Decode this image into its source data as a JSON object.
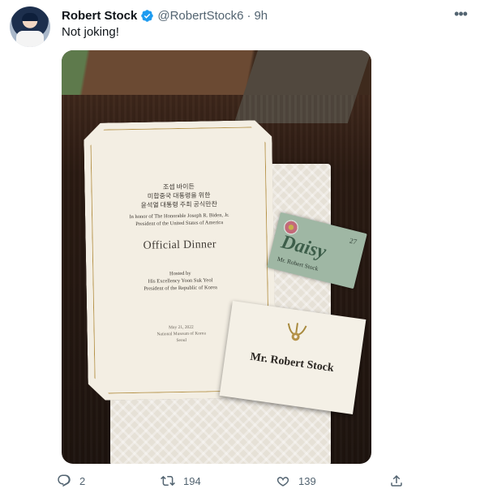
{
  "tweet": {
    "author_name": "Robert Stock",
    "handle": "@RobertStock6",
    "separator": "·",
    "time": "9h",
    "text": "Not joking!",
    "more_icon": "more-icon"
  },
  "photo": {
    "menu": {
      "korean_line1": "조셉 바이든",
      "korean_line2": "미합중국 대통령을 위한",
      "korean_line3": "윤석열 대통령 주최 공식만찬",
      "honor_line1": "In honor of The Honorable Joseph R. Biden, Jr.",
      "honor_line2": "President of the United States of America",
      "title": "Official Dinner",
      "hosted_line1": "Hosted by",
      "hosted_line2": "His Excellency Yoon Suk Yeol",
      "hosted_line3": "President of the Republic of Korea",
      "date": "May 21, 2022",
      "venue": "National Museum of Korea",
      "city": "Seoul"
    },
    "tag": {
      "number": "27",
      "flower_word": "Daisy",
      "guest": "Mr. Robert Stock"
    },
    "place_card": {
      "guest": "Mr. Robert Stock"
    }
  },
  "actions": {
    "replies": "2",
    "retweets": "194",
    "likes": "139"
  },
  "colors": {
    "text": "#0f1419",
    "secondary": "#536471",
    "verified": "#1d9bf0"
  }
}
